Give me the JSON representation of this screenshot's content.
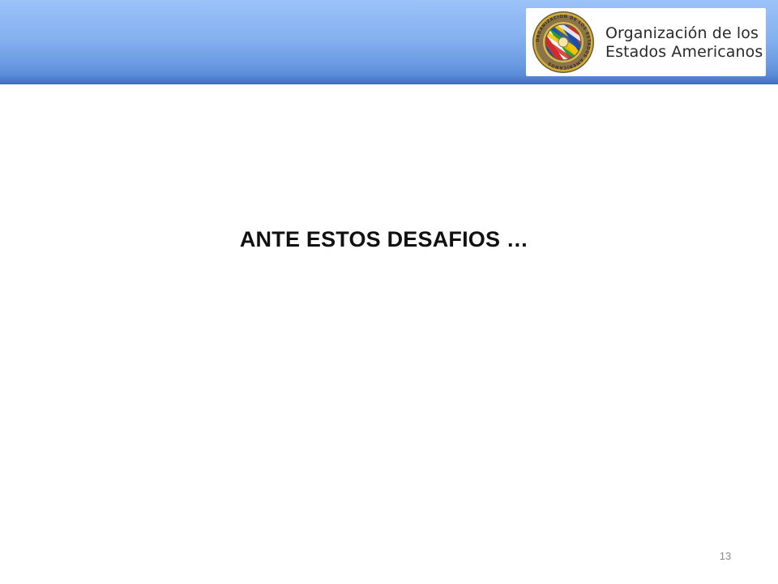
{
  "header": {
    "organization_line_1": "Organización de los",
    "organization_line_2": "Estados Americanos",
    "seal_ring_text": "ORGANIZACION DE LOS ESTADOS AMERICANOS",
    "seal_icon": "oas-seal-icon",
    "colors": {
      "band_top": "#9cc2f8",
      "band_bottom": "#4f82d0",
      "seal_ring": "#c9a227",
      "seal_ring_dark": "#6b5a3a"
    }
  },
  "slide": {
    "title": "ANTE ESTOS DESAFIOS …",
    "page_number": "13"
  }
}
